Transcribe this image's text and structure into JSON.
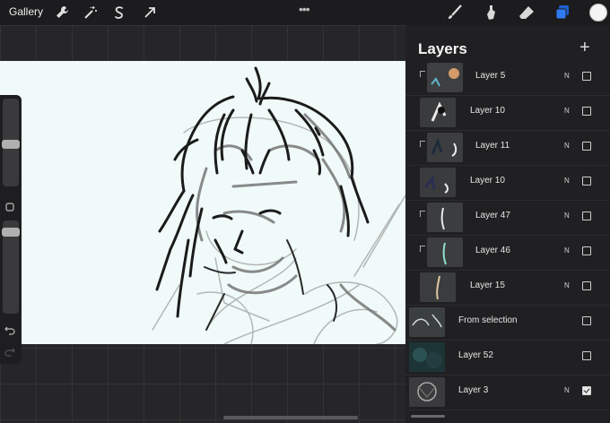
{
  "topbar": {
    "gallery_label": "Gallery",
    "left_tools": [
      "wrench-icon",
      "magic-wand-icon",
      "selection-icon",
      "transform-arrow-icon"
    ],
    "center_more": "•••",
    "right_tools": [
      "brush-icon",
      "smudge-icon",
      "eraser-icon",
      "layers-icon"
    ],
    "active_tool": "layers-icon",
    "accent_color": "#2f7bf5",
    "current_color": "#f4f4f4"
  },
  "sidebar": {
    "size_slider_level": 0.18,
    "opacity_slider_level": 0.55,
    "modify_button": "square-icon",
    "undo_icon": "undo-icon",
    "redo_icon": "redo-icon"
  },
  "layers_panel": {
    "title": "Layers",
    "add_button": "+",
    "layers": [
      {
        "name": "Layer 5",
        "blend": "N",
        "visible": false,
        "clipped": true
      },
      {
        "name": "Layer 10",
        "blend": "N",
        "visible": false,
        "clipped": false
      },
      {
        "name": "Layer 11",
        "blend": "N",
        "visible": false,
        "clipped": true
      },
      {
        "name": "Layer 10",
        "blend": "N",
        "visible": false,
        "clipped": false
      },
      {
        "name": "Layer 47",
        "blend": "N",
        "visible": false,
        "clipped": true
      },
      {
        "name": "Layer 46",
        "blend": "N",
        "visible": false,
        "clipped": true
      },
      {
        "name": "Layer 15",
        "blend": "N",
        "visible": false,
        "clipped": false
      },
      {
        "name": "From selection",
        "blend": "",
        "visible": false,
        "clipped": false
      },
      {
        "name": "Layer 52",
        "blend": "",
        "visible": false,
        "clipped": false
      },
      {
        "name": "Layer 3",
        "blend": "N",
        "visible": true,
        "clipped": false
      }
    ]
  }
}
